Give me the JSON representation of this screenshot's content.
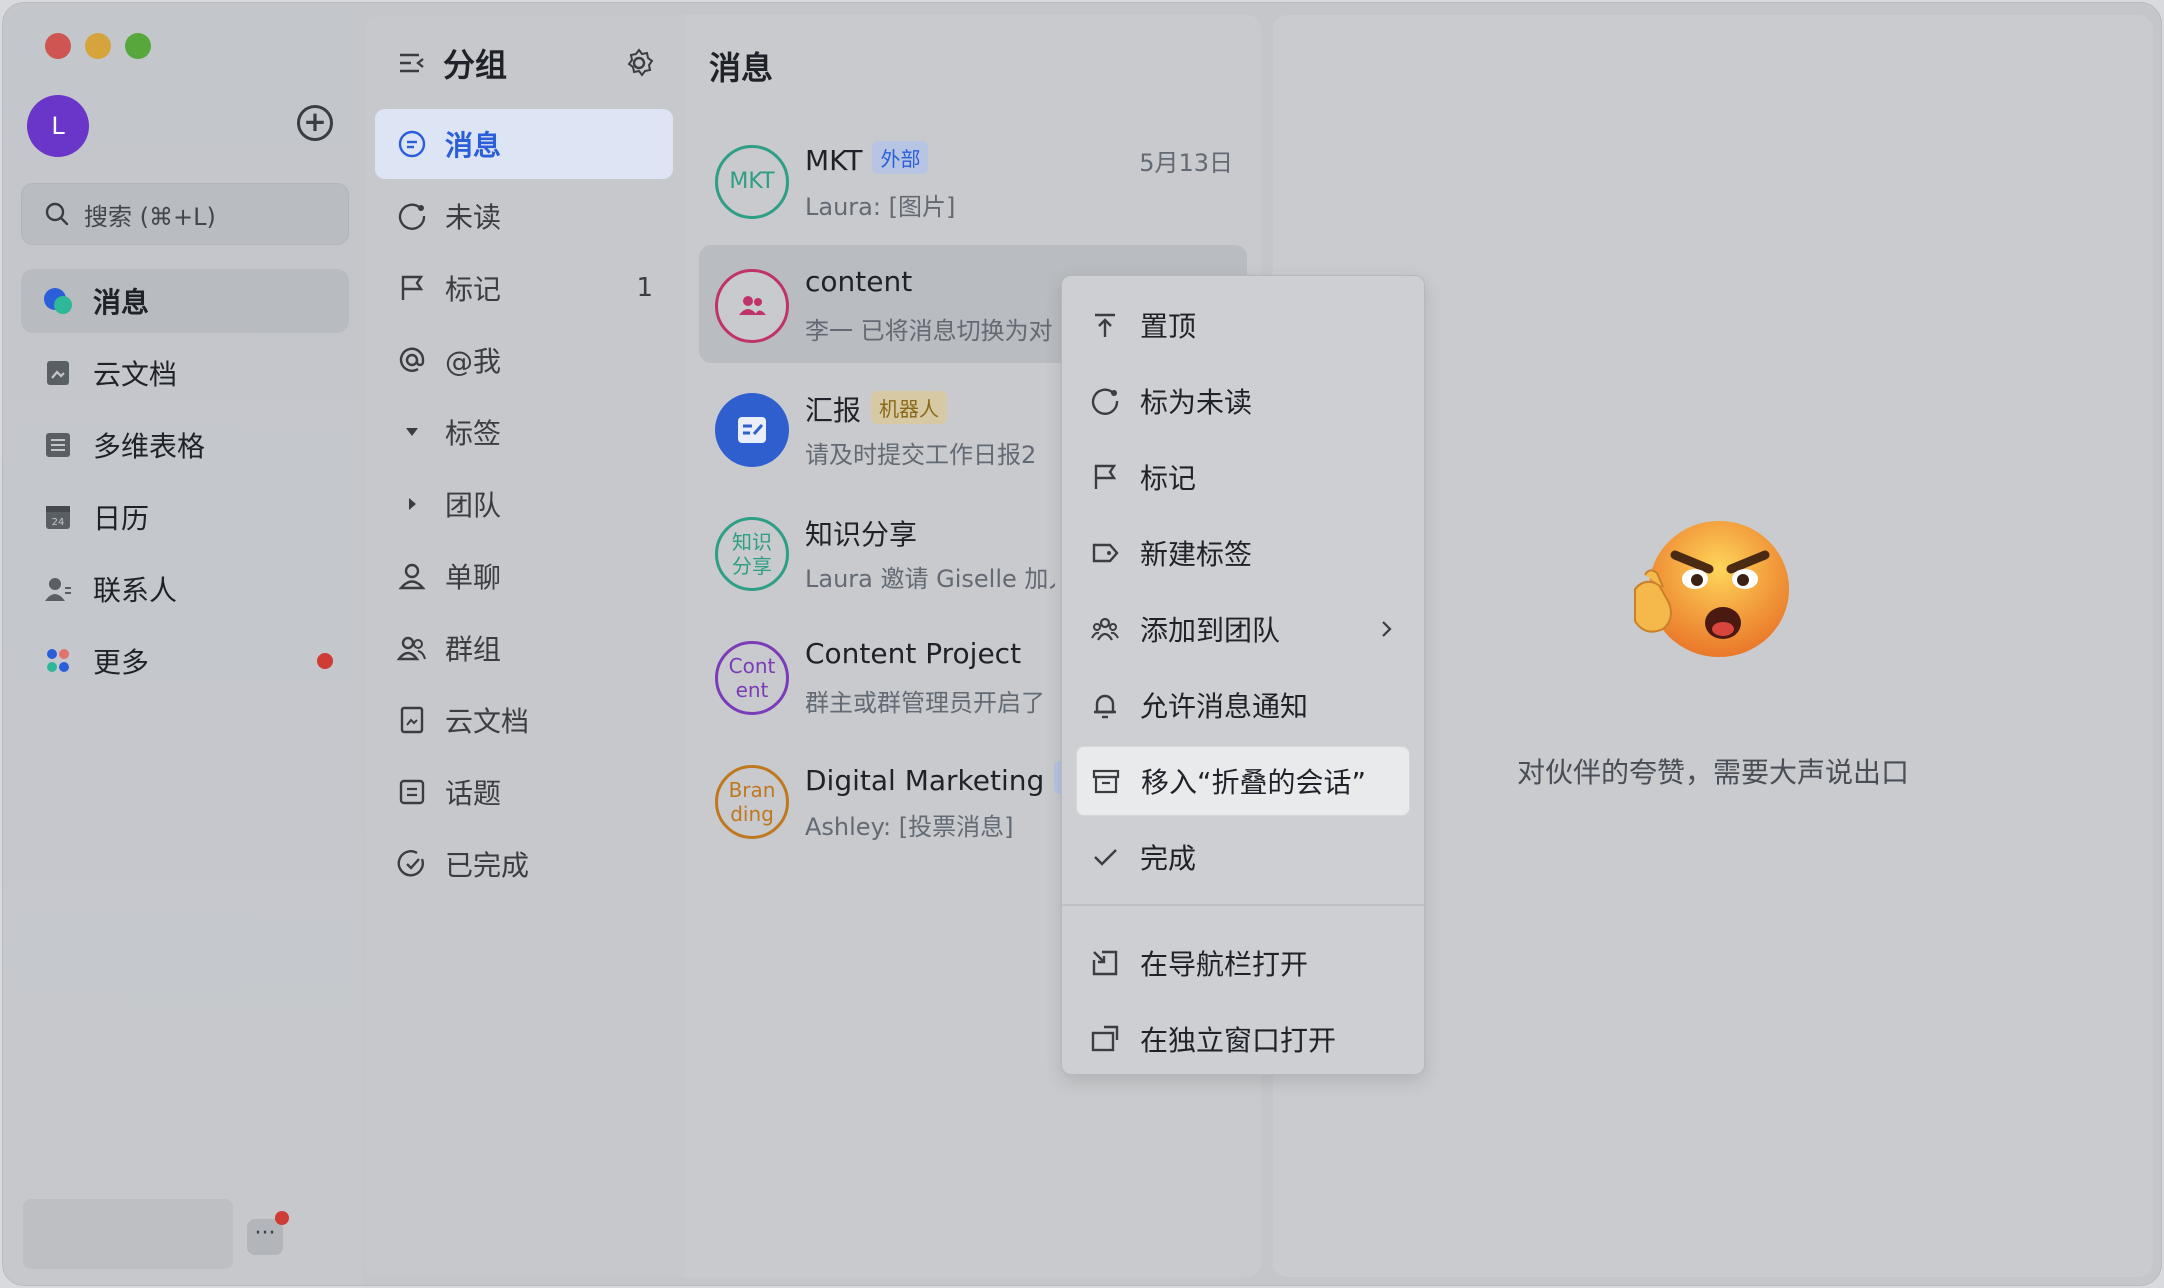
{
  "sidebar": {
    "avatar_letter": "L",
    "search_placeholder": "搜索 (⌘+L)",
    "items": [
      {
        "label": "消息",
        "icon": "message-bubble-icon",
        "active": true
      },
      {
        "label": "云文档",
        "icon": "cloud-doc-icon"
      },
      {
        "label": "多维表格",
        "icon": "multi-table-icon"
      },
      {
        "label": "日历",
        "icon": "calendar-icon"
      },
      {
        "label": "联系人",
        "icon": "contacts-icon"
      },
      {
        "label": "更多",
        "icon": "more-apps-icon",
        "badge": "red-dot"
      }
    ],
    "bottom_more": "···"
  },
  "groups": {
    "title": "分组",
    "items": [
      {
        "label": "消息",
        "icon": "chat-icon",
        "active": true
      },
      {
        "label": "未读",
        "icon": "unread-icon"
      },
      {
        "label": "标记",
        "icon": "flag-icon",
        "count": "1"
      },
      {
        "label": "@我",
        "icon": "at-icon"
      },
      {
        "label": "标签",
        "icon": "caret-down-icon"
      },
      {
        "label": "团队",
        "icon": "caret-right-icon"
      },
      {
        "label": "单聊",
        "icon": "person-icon"
      },
      {
        "label": "群组",
        "icon": "group-icon"
      },
      {
        "label": "云文档",
        "icon": "doc-icon"
      },
      {
        "label": "话题",
        "icon": "topic-icon"
      },
      {
        "label": "已完成",
        "icon": "done-icon"
      }
    ]
  },
  "chats": {
    "title": "消息",
    "items": [
      {
        "name": "MKT",
        "tag": "外部",
        "preview": "Laura: [图片]",
        "time": "5月13日",
        "avatar": "MKT",
        "avatar_color": "#2e9e84"
      },
      {
        "name": "content",
        "preview": "李一 已将消息切换为对",
        "avatar_color": "#c0336a",
        "selected": true
      },
      {
        "name": "汇报",
        "tag": "机器人",
        "preview": "请及时提交工作日报2",
        "avatar_color": "#2f5fcf"
      },
      {
        "name": "知识分享",
        "preview": "Laura 邀请 Giselle 加入",
        "avatar": "知识\n分享",
        "avatar_color": "#2e9e84"
      },
      {
        "name": "Content Project",
        "preview": "群主或群管理员开启了",
        "avatar": "Cont\nent",
        "avatar_color": "#7a3cb8"
      },
      {
        "name": "Digital Marketing",
        "tag": "部",
        "preview": "Ashley: [投票消息]",
        "avatar": "Bran\nding",
        "avatar_color": "#c07820"
      }
    ]
  },
  "menu": {
    "items": [
      {
        "label": "置顶",
        "icon": "pin-top-icon"
      },
      {
        "label": "标为未读",
        "icon": "mark-unread-icon"
      },
      {
        "label": "标记",
        "icon": "flag-icon"
      },
      {
        "label": "新建标签",
        "icon": "tag-icon"
      },
      {
        "label": "添加到团队",
        "icon": "team-icon",
        "submenu": true
      },
      {
        "label": "允许消息通知",
        "icon": "bell-icon"
      },
      {
        "label": "移入“折叠的会话”",
        "icon": "archive-icon",
        "hover": true
      },
      {
        "label": "完成",
        "icon": "check-icon"
      },
      {
        "label": "在导航栏打开",
        "icon": "open-nav-icon"
      },
      {
        "label": "在独立窗口打开",
        "icon": "open-window-icon"
      }
    ]
  },
  "detail": {
    "text": "对伙伴的夸赞，需要大声说出口",
    "emoji": "thinking-angry-emoji"
  },
  "colors": {
    "accent": "#2b5fd9",
    "active_bg": "#dde4f4",
    "red_badge": "#cf3b35"
  }
}
